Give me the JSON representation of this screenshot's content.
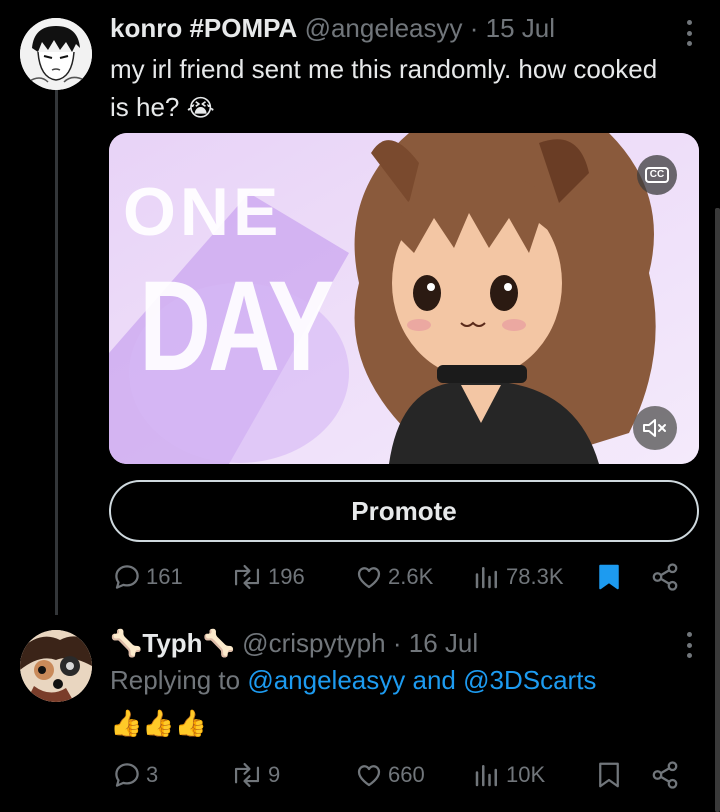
{
  "tweet": {
    "display_name": "konro #POMPA",
    "handle": "@angeleasyy",
    "separator": "·",
    "date": "15 Jul",
    "text": "my irl friend sent me this randomly. how cooked is he?",
    "emoji": "😭",
    "media": {
      "title_word_1": "ONE",
      "title_word_2": "DAY",
      "cc_label": "CC",
      "audio_state": "muted"
    },
    "promote_label": "Promote",
    "stats": {
      "replies": "161",
      "reposts": "196",
      "likes": "2.6K",
      "views": "78.3K",
      "bookmarked": true
    }
  },
  "reply": {
    "display_name": "Typh",
    "name_emoji": "🦴",
    "handle": "@crispytyph",
    "separator": "·",
    "date": "16 Jul",
    "replying_prefix": "Replying to",
    "replying_to_1": "@angeleasyy",
    "replying_joiner": "and",
    "replying_to_2": "@3DScarts",
    "text": "👍👍👍",
    "stats": {
      "replies": "3",
      "reposts": "9",
      "likes": "660",
      "views": "10K",
      "bookmarked": false
    }
  },
  "colors": {
    "background": "#000000",
    "text": "#e7e9ea",
    "muted": "#71767b",
    "accent": "#1d9bf0"
  }
}
